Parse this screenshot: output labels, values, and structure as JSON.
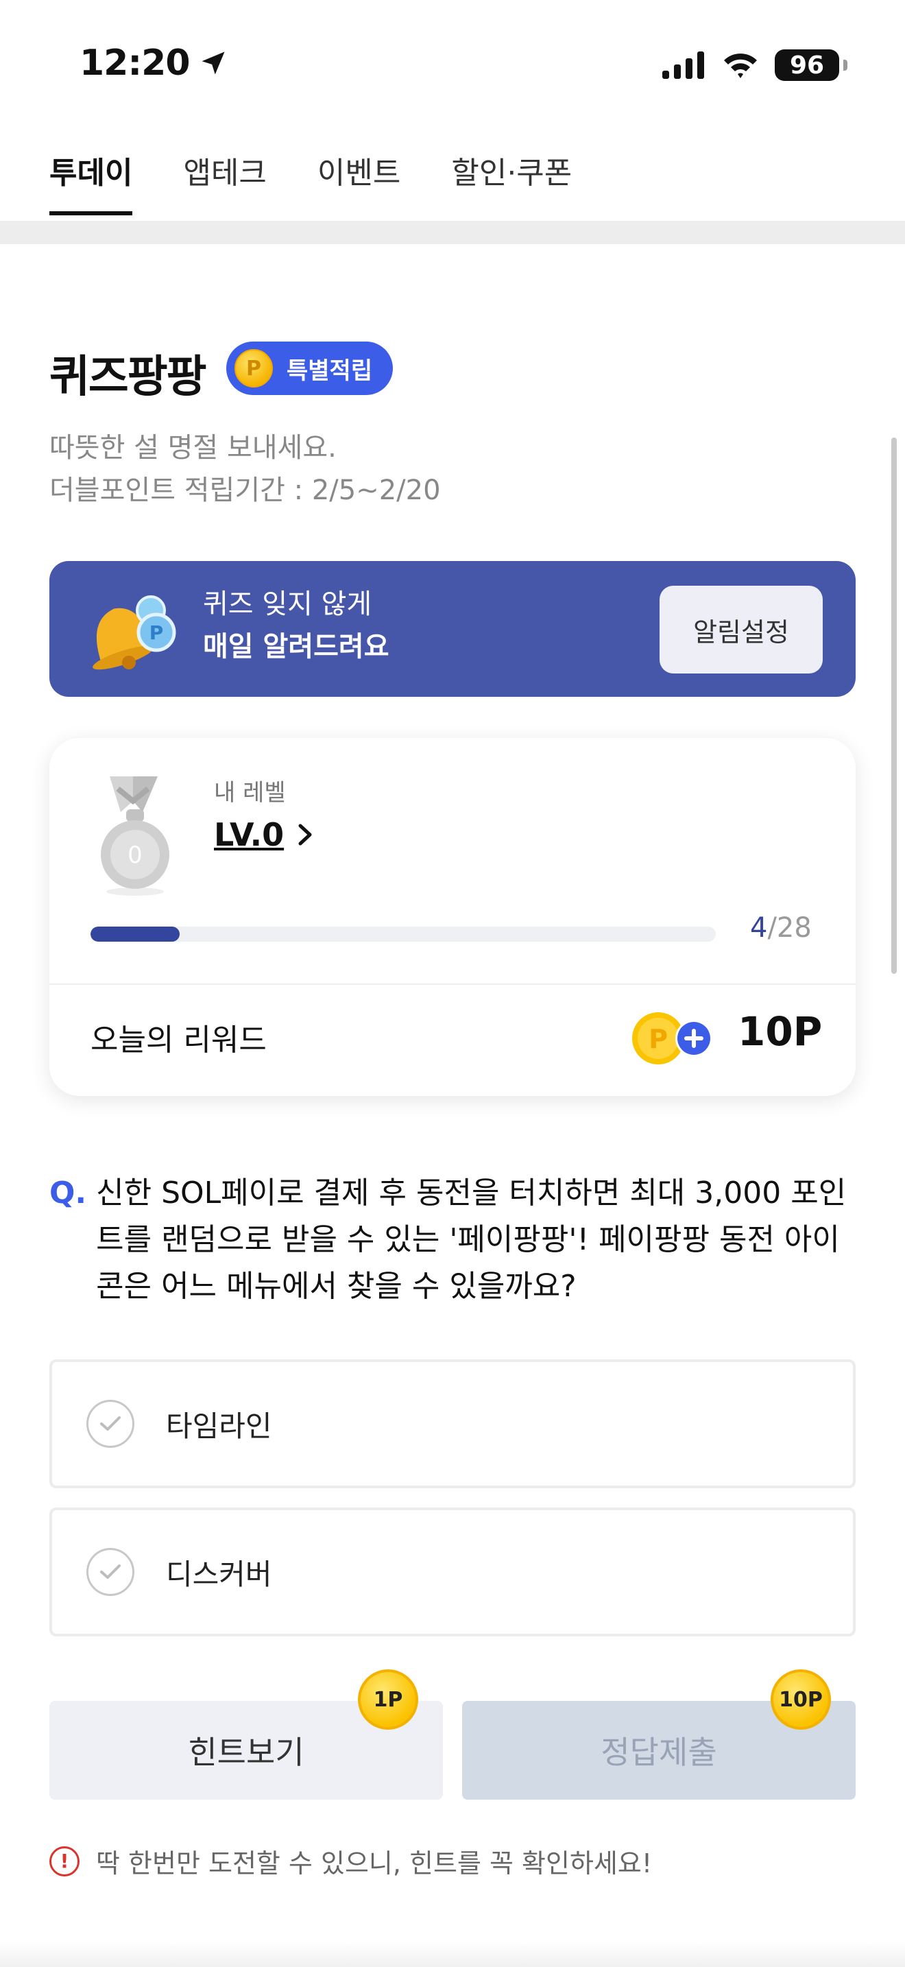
{
  "status_bar": {
    "time": "12:20",
    "battery": "96"
  },
  "tabs": [
    {
      "label": "투데이",
      "active": true
    },
    {
      "label": "앱테크",
      "active": false
    },
    {
      "label": "이벤트",
      "active": false
    },
    {
      "label": "할인·쿠폰",
      "active": false
    }
  ],
  "quiz": {
    "title": "퀴즈팡팡",
    "badge": "특별적립",
    "badge_coin": "P",
    "subtitle_lines": [
      "따뜻한 설 명절 보내세요.",
      "더블포인트 적립기간 : 2/5~2/20"
    ]
  },
  "banner": {
    "line1": "퀴즈 잊지 않게",
    "line2": "매일 알려드려요",
    "button": "알림설정"
  },
  "level_card": {
    "label": "내 레벨",
    "level": "LV.0",
    "medal_number": "0",
    "progress_current": "4",
    "progress_total": "/28",
    "progress_fraction": 0.143,
    "reward_label": "오늘의 리워드",
    "reward_value": "10P",
    "reward_coin": "P"
  },
  "question": {
    "mark": "Q.",
    "text": "신한 SOL페이로 결제 후 동전을 터치하면 최대 3,000 포인트를 랜덤으로 받을 수 있는 '페이팡팡'! 페이팡팡 동전 아이콘은 어느 메뉴에서 찾을 수 있을까요?"
  },
  "options": [
    {
      "label": "타임라인"
    },
    {
      "label": "디스커버"
    }
  ],
  "actions": {
    "hint": "힌트보기",
    "hint_cost": "1P",
    "submit": "정답제출",
    "submit_reward": "10P"
  },
  "warning": {
    "icon": "!",
    "text": "딱 한번만 도전할 수 있으니, 힌트를 꼭 확인하세요!"
  },
  "colors": {
    "accent": "#3c5de8",
    "banner": "#4656a8",
    "progress": "#34459e",
    "warning": "#d9342b"
  }
}
